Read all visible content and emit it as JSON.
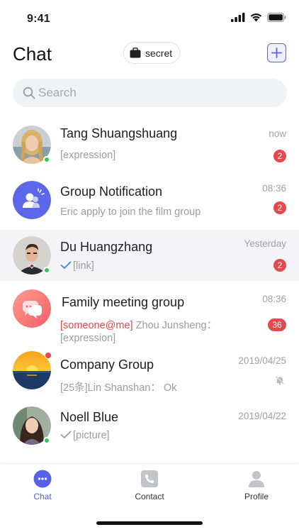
{
  "status_bar": {
    "time": "9:41"
  },
  "header": {
    "title": "Chat",
    "secret_label": "secret"
  },
  "search": {
    "placeholder": "Search"
  },
  "chats": [
    {
      "name": "Tang Shuangshuang",
      "preview": "[expression]",
      "time": "now",
      "badge": "2",
      "online": true,
      "read": false
    },
    {
      "name": "Group Notification",
      "preview": "Eric apply to join the film group",
      "time": "08:36",
      "badge": "2"
    },
    {
      "name": "Du Huangzhang",
      "preview": "[link]",
      "time": "Yesterday",
      "badge": "2",
      "online": true,
      "read": true,
      "selected": true
    },
    {
      "name": "Family meeting group",
      "mention": "[someone@me]",
      "preview": " Zhou Junsheng：",
      "preview_line2": "[expression]",
      "time": "08:36",
      "badge": "36"
    },
    {
      "name": "Company Group",
      "preview": "[25条]Lin Shanshan： Ok",
      "time": "2019/04/25",
      "muted": true,
      "alert": true
    },
    {
      "name": "Noell Blue",
      "preview": "[picture]",
      "time": "2019/04/22",
      "online": true,
      "read": true
    }
  ],
  "tabs": [
    {
      "label": "Chat",
      "icon": "chat-bubble-icon",
      "active": true
    },
    {
      "label": "Contact",
      "icon": "phone-icon"
    },
    {
      "label": "Profile",
      "icon": "person-icon"
    }
  ],
  "colors": {
    "accent": "#4f5de0",
    "badge": "#e5484d",
    "online": "#2fc761",
    "selected_row": "#f3f3f8"
  }
}
